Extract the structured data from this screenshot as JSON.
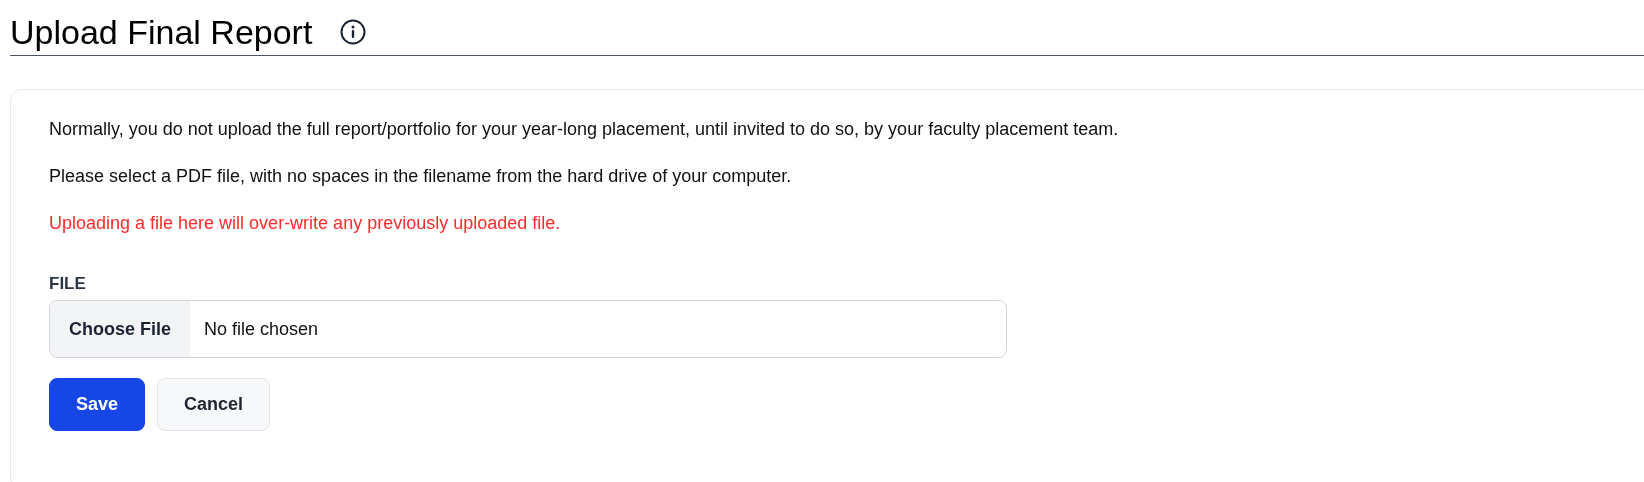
{
  "page": {
    "title": "Upload Final Report"
  },
  "card": {
    "paragraphs": [
      {
        "kind": "normal",
        "text": "Normally, you do not upload the full report/portfolio for your year-long placement, until invited to do so, by your faculty placement team."
      },
      {
        "kind": "normal",
        "text": "Please select a PDF file, with no spaces in the filename from the hard drive of your computer."
      },
      {
        "kind": "warning",
        "text": "Uploading a file here will over-write any previously uploaded file."
      }
    ],
    "file_field": {
      "label": "FILE",
      "button": "Choose File",
      "value": "No file chosen"
    },
    "buttons": [
      {
        "kind": "primary",
        "label": "Save"
      },
      {
        "kind": "secondary",
        "label": "Cancel"
      }
    ]
  }
}
